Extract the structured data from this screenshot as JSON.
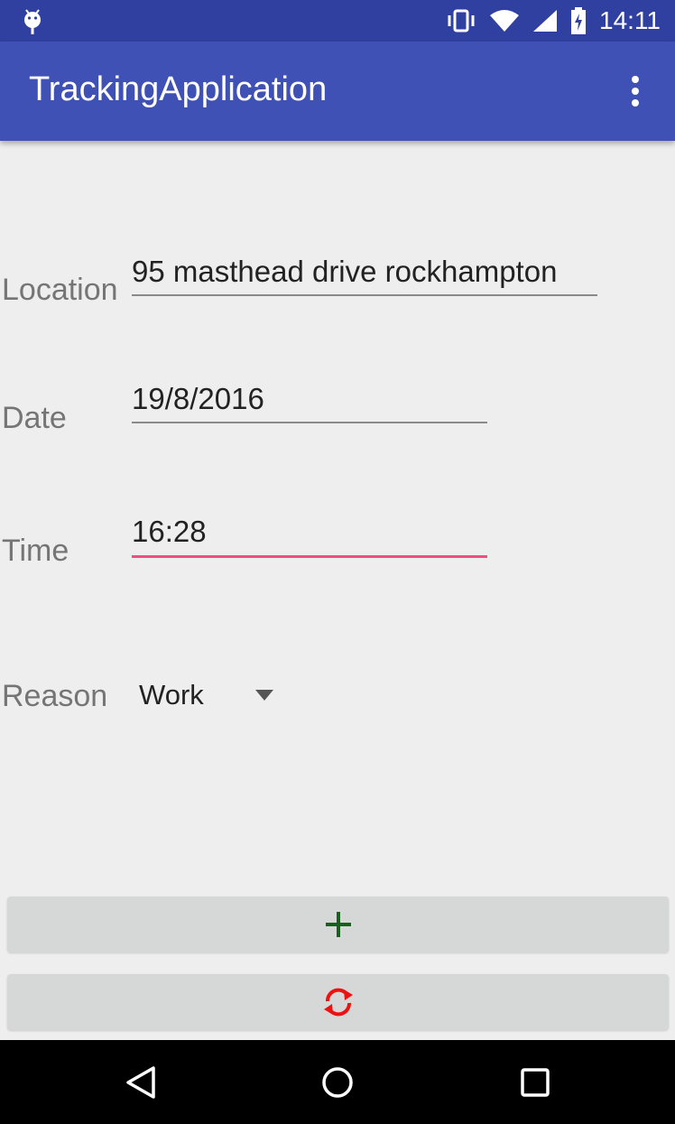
{
  "status_bar": {
    "time": "14:11",
    "icons": [
      "android-debug-icon",
      "vibrate-icon",
      "wifi-icon",
      "signal-icon",
      "battery-charging-icon"
    ]
  },
  "app_bar": {
    "title": "TrackingApplication",
    "menu_icon": "more-vert-icon"
  },
  "form": {
    "location": {
      "label": "Location",
      "value": "95 masthead drive rockhampton"
    },
    "date": {
      "label": "Date",
      "value": "19/8/2016"
    },
    "time": {
      "label": "Time",
      "value": "16:28"
    },
    "reason": {
      "label": "Reason",
      "selected": "Work"
    }
  },
  "buttons": {
    "add": {
      "icon": "plus-icon",
      "color": "#1b5e20"
    },
    "sync": {
      "icon": "sync-icon",
      "color": "#ee1111"
    }
  },
  "colors": {
    "primary": "#3f51b5",
    "primary_dark": "#3040a0",
    "accent": "#ef4f80"
  }
}
